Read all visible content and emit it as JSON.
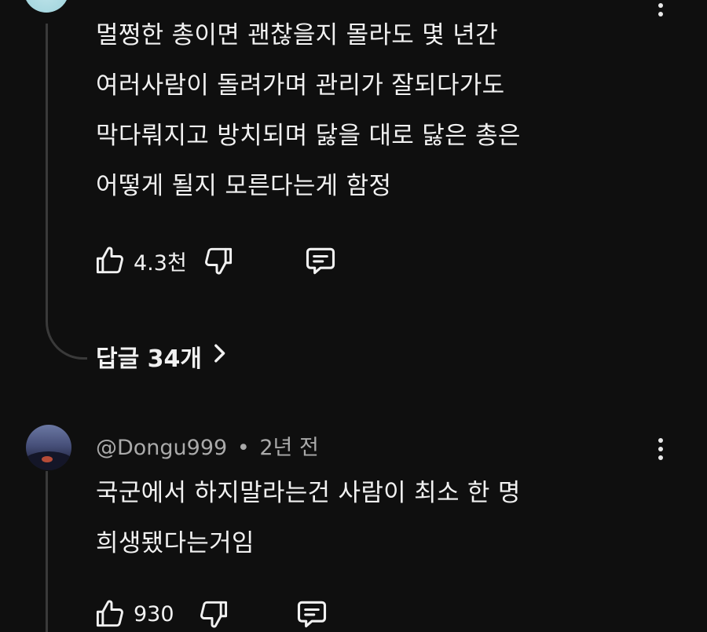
{
  "comment1": {
    "text": "멀쩡한 총이면 괜찮을지 몰라도 몇 년간\n여러사람이 돌려가며 관리가 잘되다가도\n막다뤄지고 방치되며 닳을 대로 닳은 총은\n어떻게 될지 모른다는게 함정",
    "like_count": "4.3천",
    "replies_label": "답글 34개"
  },
  "comment2": {
    "author": "@Dongu999",
    "separator": "•",
    "time": "2년 전",
    "text": "국군에서 하지말라는건 사람이 최소 한 명\n희생됐다는거임",
    "like_count": "930"
  },
  "icons": {
    "like": "thumbs-up-icon",
    "dislike": "thumbs-down-icon",
    "reply": "comment-bubble-icon",
    "more": "more-vert-icon",
    "expand": "chevron-right-icon"
  }
}
